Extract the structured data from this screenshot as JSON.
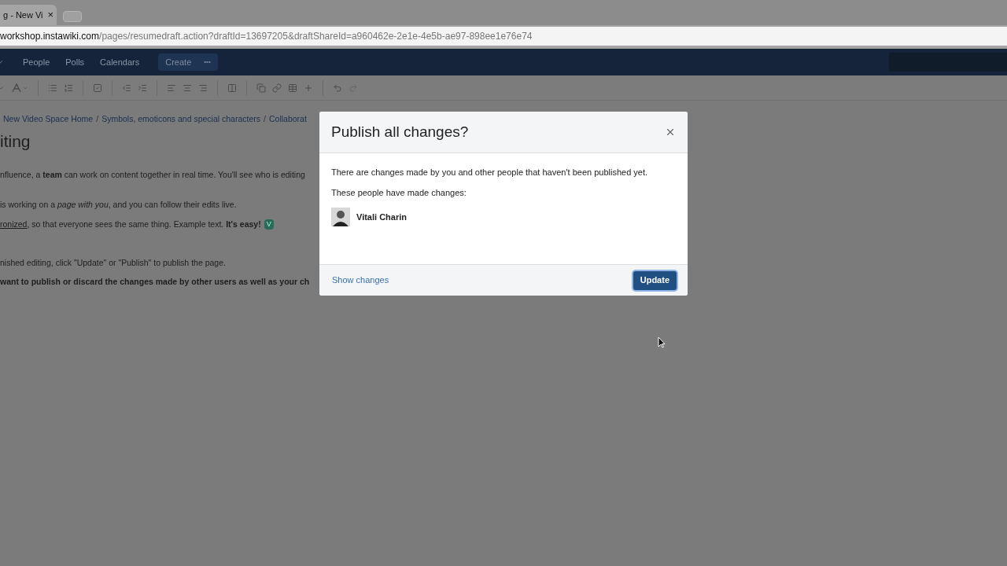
{
  "browser": {
    "tab": {
      "title": "g - New Vi",
      "close": "×"
    },
    "url": {
      "host": "workshop.instawiki.com",
      "path": "/pages/resumedraft.action?draftId=13697205&draftShareId=a960462e-2e1e-4e5b-ae97-898ee1e76e74"
    }
  },
  "nav": {
    "items": [
      {
        "label": "People"
      },
      {
        "label": "Polls"
      },
      {
        "label": "Calendars"
      }
    ],
    "create": "Create",
    "more": "•••"
  },
  "breadcrumbs": [
    {
      "label": "New Video Space Home"
    },
    {
      "separator": "/",
      "label": "Symbols, emoticons and special characters"
    },
    {
      "separator": "/",
      "label": "Collaborat"
    }
  ],
  "page": {
    "title": "iting",
    "paragraphs": [
      {
        "kind": "text",
        "text": "nfluence, a **team** can work on content together in real time. You'll see who is editing"
      },
      {
        "kind": "text",
        "text": "is working on a *page with you*, and you can follow their edits live."
      },
      {
        "kind": "link",
        "link": "ronized",
        "text": ", so that everyone sees the same thing. Example text. **It's easy!**",
        "badge": "V"
      },
      {
        "kind": "text",
        "text": "nished editing, click \"Update\" or \"Publish\" to publish the page."
      },
      {
        "kind": "bold",
        "text": "want to publish or discard the changes made by other users as well as your ch"
      }
    ]
  },
  "dialog": {
    "title": "Publish all changes?",
    "message": "There are changes made by you and other people that haven't been published yet.",
    "people_label": "These people have made changes:",
    "people": [
      {
        "name": "Vitali Charin"
      }
    ],
    "show_changes": "Show changes",
    "primary": "Update"
  }
}
